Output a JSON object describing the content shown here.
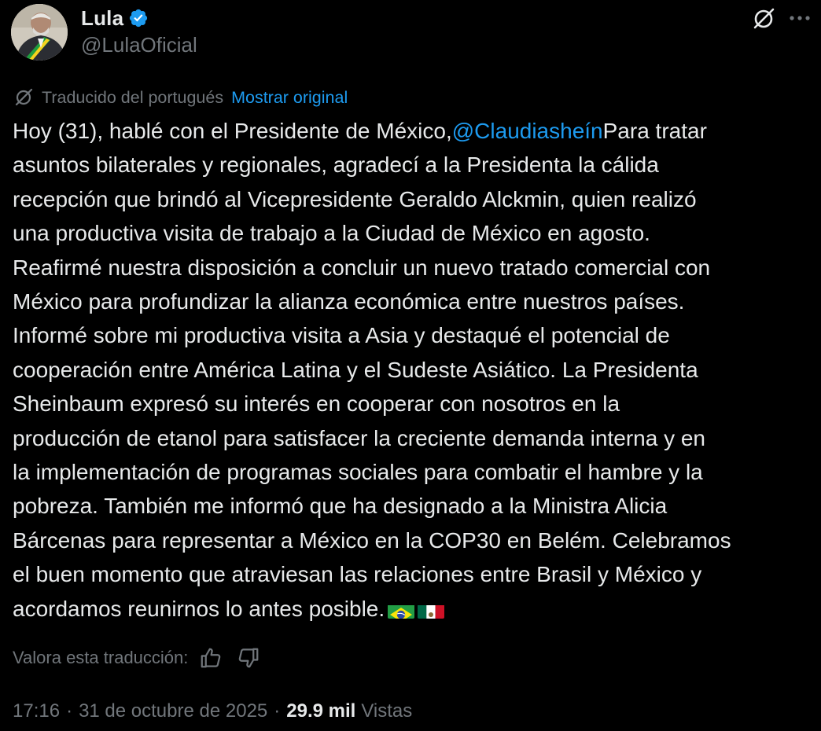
{
  "colors": {
    "background": "#000000",
    "text": "#e7e9ea",
    "muted": "#71767b",
    "link": "#1d9bf0",
    "verified": "#1d9bf0"
  },
  "author": {
    "name": "Lula",
    "handle": "@LulaOficial",
    "avatar_icon": "profile-photo-avatar",
    "verified_icon": "verified-badge-icon"
  },
  "header_actions": {
    "grok_icon": "grok-icon",
    "more_icon": "more-options-icon"
  },
  "translation": {
    "icon": "grok-translate-icon",
    "label": "Traducido del portugués",
    "show_original": "Mostrar original"
  },
  "tweet": {
    "lines": [
      "Hoy (31), hablé con el Presidente de México,",
      "asuntos bilaterales y regionales, agradecí a la Presidenta la cálida",
      "recepción que brindó al Vicepresidente Geraldo Alckmin, quien realizó",
      "una productiva visita de trabajo a la Ciudad de México en agosto.",
      "Reafirmé nuestra disposición a concluir un nuevo tratado comercial con",
      "México para profundizar la alianza económica entre nuestros países.",
      "Informé sobre mi productiva visita a Asia y destaqué el potencial de",
      "cooperación entre América Latina y el Sudeste Asiático. La Presidenta",
      "Sheinbaum expresó su interés en cooperar con nosotros en la",
      "producción de etanol para satisfacer la creciente demanda interna y en",
      "la implementación de programas sociales para combatir el hambre y la",
      "pobreza. También me informó que ha designado a la Ministra Alicia",
      "Bárcenas para representar a México en la COP30 en Belém. Celebramos",
      "el buen momento que atraviesan las relaciones entre Brasil y México y",
      "acordamos reunirnos lo antes posible."
    ],
    "mention": "@Claudiasheín",
    "after_mention": "Para tratar",
    "flags": [
      "brazil-flag-icon",
      "mexico-flag-icon"
    ]
  },
  "rating": {
    "label": "Valora esta traducción:",
    "up_icon": "thumbs-up-icon",
    "down_icon": "thumbs-down-icon"
  },
  "meta": {
    "time": "17:16",
    "separator": "·",
    "date": "31 de octubre de 2025",
    "views_count": "29.9 mil",
    "views_label": "Vistas"
  }
}
